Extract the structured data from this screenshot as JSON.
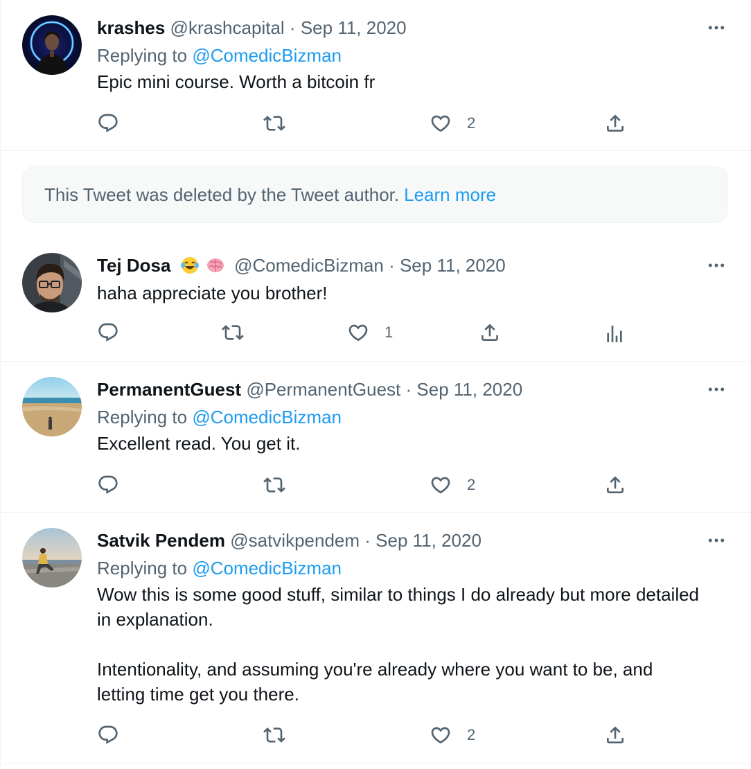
{
  "tweets": [
    {
      "name": "krashes",
      "handle": "@krashcapital",
      "dot": "·",
      "date": "Sep 11, 2020",
      "replying_label": "Replying to",
      "replying_mention": "@ComedicBizman",
      "text": "Epic mini course. Worth a bitcoin fr",
      "like_count": "2",
      "avatar": "dark-portrait-blue-neon-ring"
    },
    {
      "name": "Tej Dosa",
      "emojis": [
        "face-with-tears-of-joy-emoji",
        "brain-emoji"
      ],
      "handle": "@ComedicBizman",
      "dot": "·",
      "date": "Sep 11, 2020",
      "text": "haha appreciate you brother!",
      "like_count": "1",
      "avatar": "man-with-glasses-portrait"
    },
    {
      "name": "PermanentGuest",
      "handle": "@PermanentGuest",
      "dot": "·",
      "date": "Sep 11, 2020",
      "replying_label": "Replying to",
      "replying_mention": "@ComedicBizman",
      "text": "Excellent read. You get it.",
      "like_count": "2",
      "avatar": "beach-landscape"
    },
    {
      "name": "Satvik Pendem",
      "handle": "@satvikpendem",
      "dot": "·",
      "date": "Sep 11, 2020",
      "replying_label": "Replying to",
      "replying_mention": "@ComedicBizman",
      "text": "Wow this is some good stuff, similar to things I do already but more detailed\nin explanation.\n\nIntentionality, and assuming you're already where you want to be, and\nletting time get you there.",
      "like_count": "2",
      "avatar": "person-sitting-by-sea"
    }
  ],
  "deleted_notice": {
    "text": "This Tweet was deleted by the Tweet author.",
    "link": "Learn more"
  },
  "icons": {
    "reply": "reply-icon",
    "retweet": "retweet-icon",
    "like": "heart-icon",
    "share": "share-icon",
    "analytics": "analytics-icon",
    "more": "more-icon"
  },
  "colors": {
    "link": "#1d9bf0",
    "secondary_text": "#536471",
    "primary_text": "#0f1419",
    "divider": "#eff3f4",
    "deleted_bg": "#f7f9f9"
  }
}
